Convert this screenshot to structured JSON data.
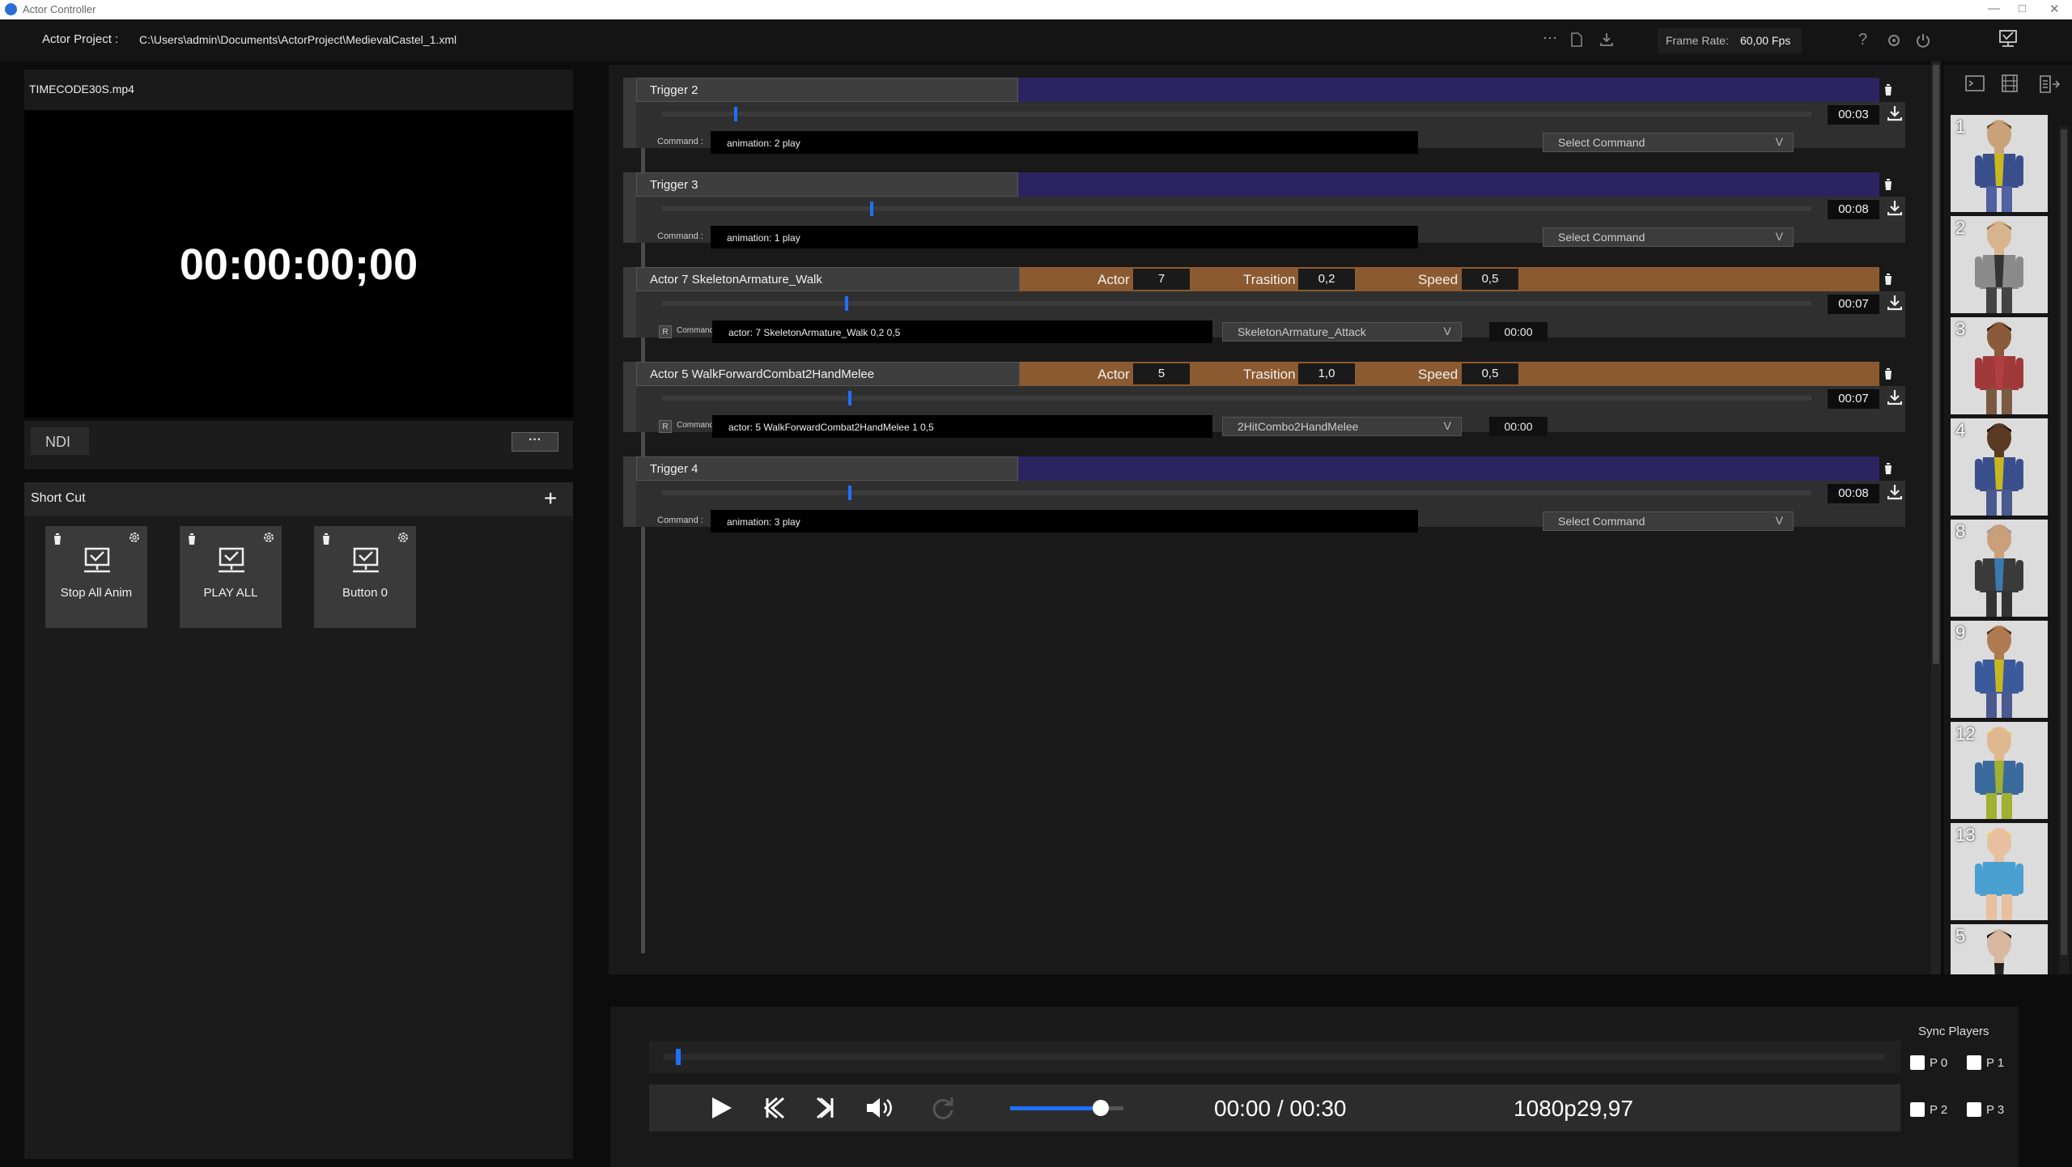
{
  "window": {
    "title": "Actor Controller"
  },
  "header": {
    "project_label": "Actor Project :",
    "project_path": "C:\\Users\\admin\\Documents\\ActorProject\\MedievalCastel_1.xml",
    "more_label": "···",
    "frame_rate_label": "Frame Rate:",
    "frame_rate_value": "60,00 Fps",
    "help_label": "?"
  },
  "video": {
    "filename": "TIMECODE30S.mp4",
    "timecode": "00:00:00;00",
    "ndi_label": "NDI",
    "more_label": "···"
  },
  "shortcuts": {
    "title": "Short Cut",
    "add_label": "+",
    "items": [
      {
        "label": "Stop All Anim"
      },
      {
        "label": "PLAY ALL"
      },
      {
        "label": "Button 0"
      }
    ]
  },
  "rows": [
    {
      "type": "trigger",
      "title": "Trigger 2",
      "time": "00:03",
      "command_label": "Command :",
      "command": "animation: 2 play",
      "select": "Select Command",
      "progress": 0.063
    },
    {
      "type": "trigger",
      "title": "Trigger 3",
      "time": "00:08",
      "command_label": "Command :",
      "command": "animation: 1 play",
      "select": "Select Command",
      "progress": 0.181
    },
    {
      "type": "actor",
      "title": "Actor 7 SkeletonArmature_Walk",
      "actor_label": "Actor",
      "actor_value": "7",
      "transition_label": "Trasition",
      "transition_value": "0,2",
      "speed_label": "Speed",
      "speed_value": "0,5",
      "time": "00:07",
      "r_label": "R",
      "command_label": "Command :",
      "command": "actor: 7 SkeletonArmature_Walk 0,2 0,5",
      "select": "SkeletonArmature_Attack",
      "offset": "00:00",
      "progress": 0.159
    },
    {
      "type": "actor",
      "title": "Actor 5 WalkForwardCombat2HandMelee",
      "actor_label": "Actor",
      "actor_value": "5",
      "transition_label": "Trasition",
      "transition_value": "1,0",
      "speed_label": "Speed",
      "speed_value": "0,5",
      "time": "00:07",
      "r_label": "R",
      "command_label": "Command :",
      "command": "actor: 5 WalkForwardCombat2HandMelee 1 0,5",
      "select": "2HitCombo2HandMelee",
      "offset": "00:00",
      "progress": 0.162
    },
    {
      "type": "trigger",
      "title": "Trigger 4",
      "time": "00:08",
      "command_label": "Command :",
      "command": "animation: 3 play",
      "select": "Select Command",
      "progress": 0.162
    }
  ],
  "actors": [
    {
      "id": "1",
      "skin": "#c9a27a",
      "hair": "#6b4a2a",
      "top": "#3a4e8c",
      "inner": "#c8b820",
      "legs": "#5060a0"
    },
    {
      "id": "2",
      "skin": "#d8b48e",
      "hair": "#8a6a4a",
      "top": "#8a8a8a",
      "inner": "#333333",
      "legs": "#444444"
    },
    {
      "id": "3",
      "skin": "#8a5a3a",
      "hair": "#2a1a10",
      "top": "#a03a3a",
      "inner": "#b04040",
      "legs": "#7a5a40"
    },
    {
      "id": "4",
      "skin": "#5a3a22",
      "hair": "#1a1008",
      "top": "#3a4e8c",
      "inner": "#c8b820",
      "legs": "#4a5a90"
    },
    {
      "id": "8",
      "skin": "#caa07a",
      "hair": "#9a9a9a",
      "top": "#3a3a3a",
      "inner": "#3a7ab0",
      "legs": "#333333"
    },
    {
      "id": "9",
      "skin": "#b07a50",
      "hair": "#4a3020",
      "top": "#3a5a9c",
      "inner": "#c8b820",
      "legs": "#4a5a90"
    },
    {
      "id": "12",
      "skin": "#e0b890",
      "hair": "#e0c860",
      "top": "#3a6a9c",
      "inner": "#a0b030",
      "legs": "#a0b030"
    },
    {
      "id": "13",
      "skin": "#e8c0a0",
      "hair": "#f0d060",
      "top": "#4aa0d0",
      "inner": "#4aa0d0",
      "legs": "#e8c0a0"
    },
    {
      "id": "5",
      "skin": "#d8b8a0",
      "hair": "#111111",
      "top": "#dddddd",
      "inner": "#222222",
      "legs": "#333333"
    }
  ],
  "player": {
    "time": "00:00 / 00:30",
    "format": "1080p29,97",
    "sync_label": "Sync Players",
    "sync": [
      "P 0",
      "P 1",
      "P 2",
      "P 3"
    ],
    "progress": 0.01,
    "volume": 0.8
  },
  "colors": {
    "trigger_bar": "#2c2460",
    "actor_bar": "#8c5a30",
    "accent": "#1f6fff"
  }
}
